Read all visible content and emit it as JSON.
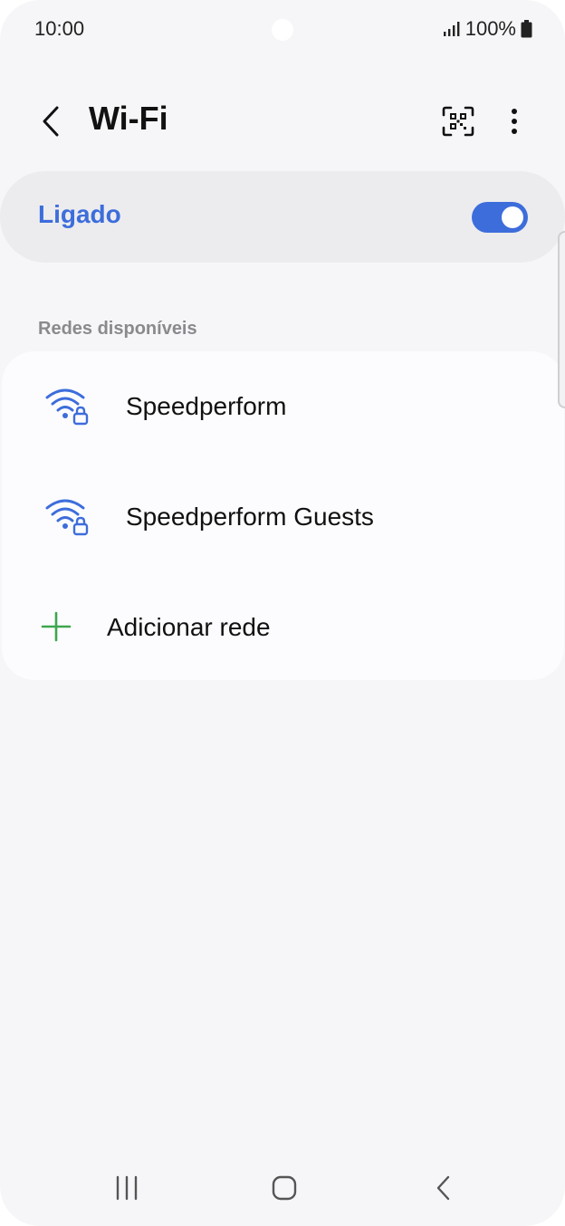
{
  "status_bar": {
    "time": "10:00",
    "battery": "100%"
  },
  "header": {
    "title": "Wi-Fi",
    "back_icon": "chevron-left-icon",
    "qr_icon": "qr-scan-icon",
    "more_icon": "more-vertical-icon"
  },
  "wifi_toggle": {
    "label": "Ligado",
    "on": true
  },
  "available_networks": {
    "header": "Redes disponíveis",
    "networks": [
      {
        "name": "Speedperform",
        "icon": "wifi-locked-icon"
      },
      {
        "name": "Speedperform Guests",
        "icon": "wifi-locked-icon"
      }
    ],
    "add_network": {
      "label": "Adicionar rede",
      "icon": "plus-icon"
    }
  },
  "colors": {
    "accent": "#3d6ddb",
    "add_green": "#3fa64f",
    "background": "#f6f6f8",
    "card": "#fcfcfe",
    "toggle_card": "#ececef",
    "section_header": "#8a8a8e"
  },
  "nav_bar": {
    "recents_icon": "recents-icon",
    "home_icon": "home-icon",
    "back_icon": "back-icon"
  }
}
